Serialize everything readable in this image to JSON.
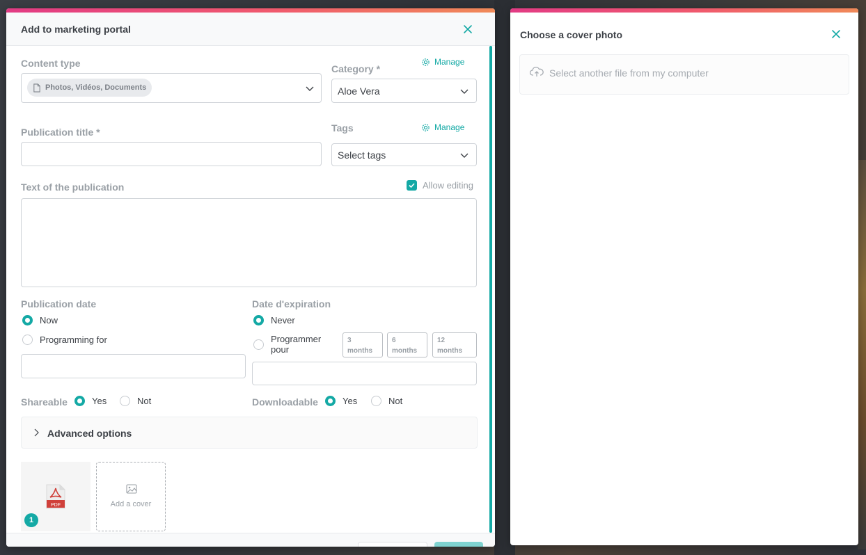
{
  "main_modal": {
    "title": "Add to marketing portal",
    "content_type": {
      "label": "Content type",
      "value": "Photos, Vidéos, Documents"
    },
    "category": {
      "label": "Category *",
      "value": "Aloe Vera",
      "manage_label": "Manage"
    },
    "publication_title": {
      "label": "Publication title *",
      "value": ""
    },
    "tags": {
      "label": "Tags",
      "placeholder": "Select tags",
      "manage_label": "Manage"
    },
    "text": {
      "label": "Text of the publication",
      "value": "",
      "allow_editing_label": "Allow editing",
      "allow_editing_checked": true
    },
    "publication_date": {
      "label": "Publication date",
      "options": [
        "Now",
        "Programming for"
      ],
      "selected": "Now",
      "value": ""
    },
    "expiration_date": {
      "label": "Date d'expiration",
      "option_never": "Never",
      "option_program": "Programmer pour",
      "selected": "Never",
      "presets": [
        {
          "n": "3",
          "unit": "months"
        },
        {
          "n": "6",
          "unit": "months"
        },
        {
          "n": "12",
          "unit": "months"
        }
      ],
      "value": ""
    },
    "shareable": {
      "label": "Shareable",
      "yes": "Yes",
      "no": "Not",
      "selected": "Yes"
    },
    "downloadable": {
      "label": "Downloadable",
      "yes": "Yes",
      "no": "Not",
      "selected": "Yes"
    },
    "advanced_options_label": "Advanced options",
    "file": {
      "type_label": "PDF",
      "count": "1"
    },
    "add_cover_label": "Add a cover"
  },
  "side_modal": {
    "title": "Choose a cover photo",
    "upload_label": "Select another file from my computer"
  },
  "colors": {
    "accent": "#14a9a5",
    "gradient_start": "#e23b84",
    "gradient_end": "#f08a58"
  }
}
